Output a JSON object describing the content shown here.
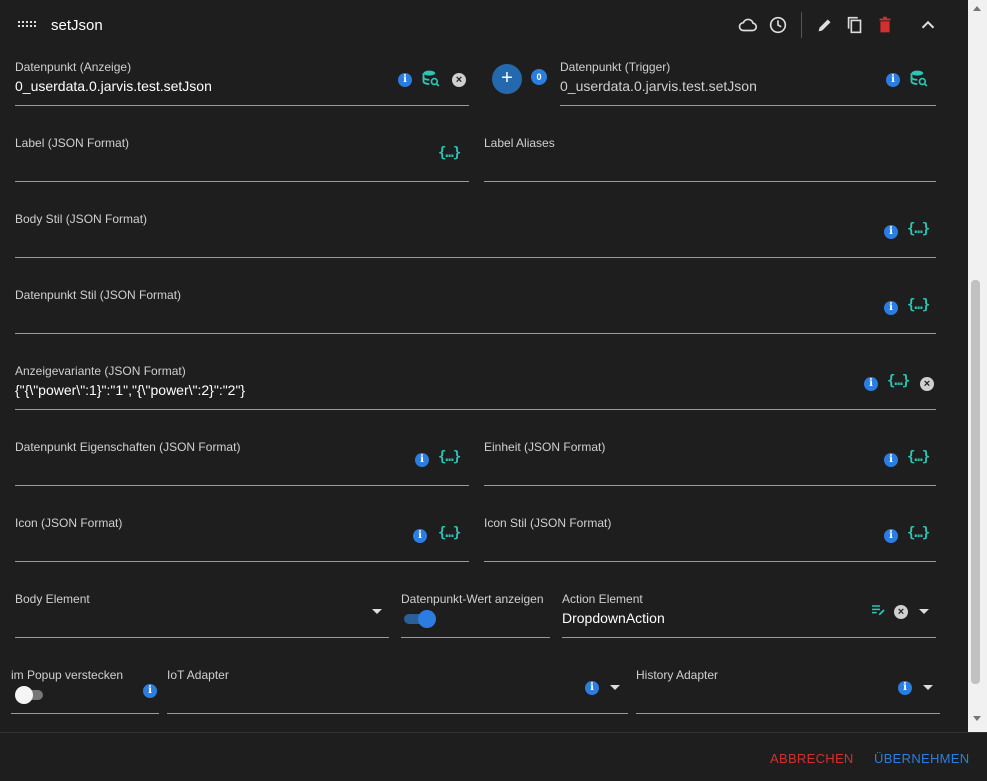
{
  "header": {
    "title": "setJson",
    "icons": [
      "cloud-icon",
      "history-icon",
      "edit-icon",
      "copy-icon",
      "delete-icon",
      "collapse-icon"
    ]
  },
  "fields": {
    "dp_display": {
      "label": "Datenpunkt (Anzeige)",
      "value": "0_userdata.0.jarvis.test.setJson"
    },
    "dp_trigger": {
      "label": "Datenpunkt (Trigger)",
      "value": "0_userdata.0.jarvis.test.setJson",
      "count": "0"
    },
    "label_json": {
      "label": "Label (JSON Format)"
    },
    "label_aliases": {
      "label": "Label Aliases"
    },
    "body_style": {
      "label": "Body Stil (JSON Format)"
    },
    "dp_style": {
      "label": "Datenpunkt Stil (JSON Format)"
    },
    "display_variant": {
      "label": "Anzeigevariante (JSON Format)",
      "value": "{\"{\\\"power\\\":1}\":\"1\",\"{\\\"power\\\":2}\":\"2\"}"
    },
    "dp_properties": {
      "label": "Datenpunkt Eigenschaften (JSON Format)"
    },
    "unit": {
      "label": "Einheit (JSON Format)"
    },
    "icon": {
      "label": "Icon (JSON Format)"
    },
    "icon_style": {
      "label": "Icon Stil (JSON Format)"
    },
    "body_element": {
      "label": "Body Element"
    },
    "show_dp_value": {
      "label": "Datenpunkt-Wert anzeigen",
      "on": true
    },
    "action_element": {
      "label": "Action Element",
      "value": "DropdownAction"
    },
    "hide_in_popup": {
      "label": "im Popup verstecken",
      "on": false
    },
    "iot_adapter": {
      "label": "IoT Adapter"
    },
    "history_adapter": {
      "label": "History Adapter"
    }
  },
  "footer": {
    "cancel": "ABBRECHEN",
    "apply": "ÜBERNEHMEN"
  },
  "glyphs": {
    "json": "{…}",
    "info": "i",
    "clear": "×",
    "add": "+"
  },
  "colors": {
    "accent": "#2b7de0",
    "json_icon": "#2ec4b6",
    "delete": "#d32f2f",
    "cancel": "#d32f2f",
    "apply": "#2b7de0",
    "toggle_on": "#2b7de0"
  }
}
